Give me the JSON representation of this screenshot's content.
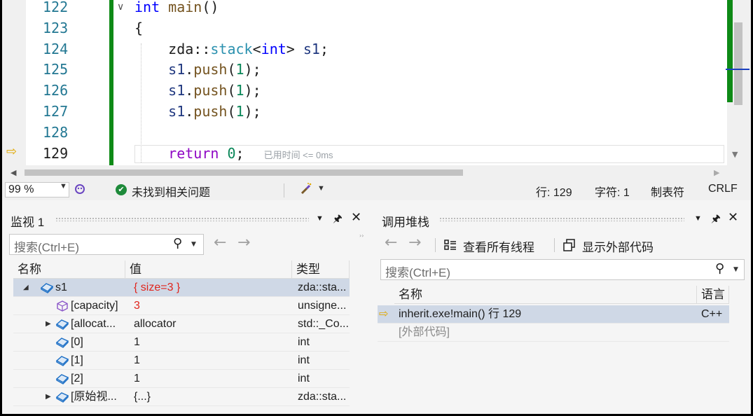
{
  "editor": {
    "lines": [
      {
        "num": "122",
        "fold": "∨",
        "code": [
          {
            "t": "int",
            "c": "kw"
          },
          {
            "t": " main",
            "c": "fn"
          },
          {
            "t": "()",
            "c": "pl"
          }
        ]
      },
      {
        "num": "123",
        "code": [
          {
            "t": "{",
            "c": "pl"
          }
        ]
      },
      {
        "num": "124",
        "code": [
          {
            "t": "    zda",
            "c": "pl"
          },
          {
            "t": "::",
            "c": "pl"
          },
          {
            "t": "stack",
            "c": "ty"
          },
          {
            "t": "<",
            "c": "pl"
          },
          {
            "t": "int",
            "c": "kw"
          },
          {
            "t": "> ",
            "c": "pl"
          },
          {
            "t": "s1",
            "c": "id"
          },
          {
            "t": ";",
            "c": "pl"
          }
        ]
      },
      {
        "num": "125",
        "code": [
          {
            "t": "    s1",
            "c": "id"
          },
          {
            "t": ".",
            "c": "pl"
          },
          {
            "t": "push",
            "c": "fn"
          },
          {
            "t": "(",
            "c": "pl"
          },
          {
            "t": "1",
            "c": "nm"
          },
          {
            "t": ");",
            "c": "pl"
          }
        ]
      },
      {
        "num": "126",
        "code": [
          {
            "t": "    s1",
            "c": "id"
          },
          {
            "t": ".",
            "c": "pl"
          },
          {
            "t": "push",
            "c": "fn"
          },
          {
            "t": "(",
            "c": "pl"
          },
          {
            "t": "1",
            "c": "nm"
          },
          {
            "t": ");",
            "c": "pl"
          }
        ]
      },
      {
        "num": "127",
        "code": [
          {
            "t": "    s1",
            "c": "id"
          },
          {
            "t": ".",
            "c": "pl"
          },
          {
            "t": "push",
            "c": "fn"
          },
          {
            "t": "(",
            "c": "pl"
          },
          {
            "t": "1",
            "c": "nm"
          },
          {
            "t": ");",
            "c": "pl"
          }
        ]
      },
      {
        "num": "128",
        "code": []
      },
      {
        "num": "129",
        "current": true,
        "code": [
          {
            "t": "    return",
            "c": "rt"
          },
          {
            "t": " ",
            "c": "pl"
          },
          {
            "t": "0",
            "c": "nm"
          },
          {
            "t": ";",
            "c": "pl"
          }
        ]
      }
    ],
    "elapsed_hint": "已用时间 <= 0ms"
  },
  "status": {
    "zoom": "99 %",
    "issues": "未找到相关问题",
    "line": "行: 129",
    "char": "字符: 1",
    "indent": "制表符",
    "eol": "CRLF"
  },
  "watch": {
    "title": "监视 1",
    "search_placeholder": "搜索(Ctrl+E)",
    "columns": [
      "名称",
      "值",
      "类型"
    ],
    "rows": [
      {
        "expander": "◢",
        "name": "s1",
        "value": "{ size=3 }",
        "value_red": true,
        "type": "zda::sta...",
        "selected": true,
        "indent": 0,
        "icon": "object-icon"
      },
      {
        "expander": "",
        "name": "[capacity]",
        "value": "3",
        "value_red": true,
        "type": "unsigne...",
        "indent": 1,
        "icon": "field-icon"
      },
      {
        "expander": "▶",
        "name": "[allocat...",
        "value": "allocator",
        "type": "std::_Co...",
        "indent": 1,
        "icon": "object-icon"
      },
      {
        "expander": "",
        "name": "[0]",
        "value": "1",
        "type": "int",
        "indent": 1,
        "icon": "object-icon"
      },
      {
        "expander": "",
        "name": "[1]",
        "value": "1",
        "type": "int",
        "indent": 1,
        "icon": "object-icon"
      },
      {
        "expander": "",
        "name": "[2]",
        "value": "1",
        "type": "int",
        "indent": 1,
        "icon": "object-icon"
      },
      {
        "expander": "▶",
        "name": "[原始视...",
        "value": "{...}",
        "type": "zda::sta...",
        "indent": 1,
        "icon": "object-icon"
      }
    ]
  },
  "callstack": {
    "title": "调用堆栈",
    "show_threads": "查看所有线程",
    "show_external": "显示外部代码",
    "search_placeholder": "搜索(Ctrl+E)",
    "columns": [
      "名称",
      "语言"
    ],
    "rows": [
      {
        "name": "inherit.exe!main() 行 129",
        "lang": "C++",
        "selected": true,
        "current": true
      },
      {
        "name": "[外部代码]",
        "lang": "",
        "muted": true
      }
    ]
  }
}
